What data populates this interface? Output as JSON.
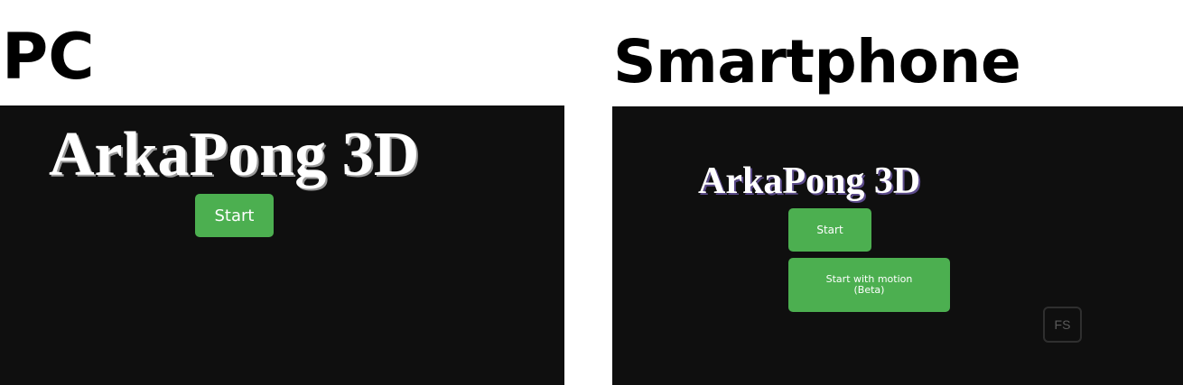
{
  "pc": {
    "heading": "PC",
    "game_title": "ArkaPong 3D",
    "start_label": "Start"
  },
  "smartphone": {
    "heading": "Smartphone",
    "game_title": "ArkaPong 3D",
    "start_label": "Start",
    "motion_label_line1": "Start with motion",
    "motion_label_line2": "(Beta)",
    "fullscreen_label": "FS"
  },
  "colors": {
    "screen_background": "#0f0f0f",
    "button_green": "#4caf50",
    "title_white": "#ffffff"
  }
}
